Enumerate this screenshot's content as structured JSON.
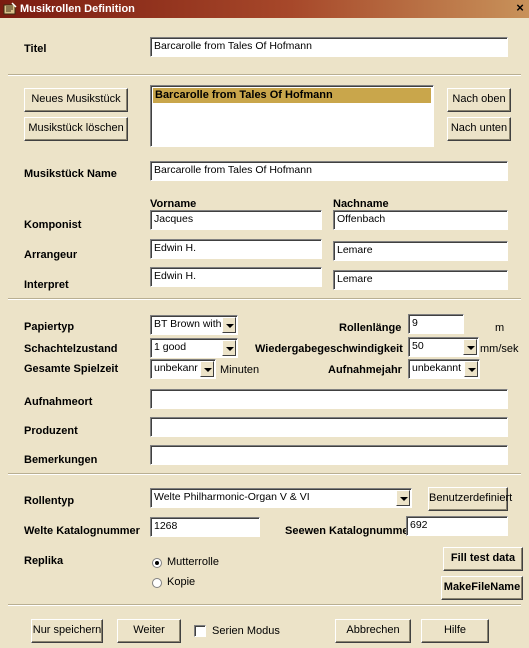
{
  "window": {
    "title": "Musikrollen Definition",
    "close_glyph": "×"
  },
  "titel": {
    "label": "Titel",
    "value": "Barcarolle from Tales Of Hofmann"
  },
  "buttons": {
    "new_piece": "Neues Musikstück",
    "delete_piece": "Musikstück löschen",
    "move_up": "Nach oben",
    "move_down": "Nach unten",
    "custom": "Benutzerdefiniert",
    "fill_test": "Fill test data",
    "make_file_name": "MakeFileName",
    "save_only": "Nur speichern",
    "next": "Weiter",
    "cancel": "Abbrechen",
    "help": "Hilfe"
  },
  "piece_list": {
    "items": [
      "Barcarolle from Tales Of Hofmann"
    ],
    "selected_index": 0
  },
  "piece_name": {
    "label": "Musikstück Name",
    "value": "Barcarolle from Tales Of Hofmann"
  },
  "people": {
    "col_first": "Vorname",
    "col_last": "Nachname",
    "rows": [
      {
        "label": "Komponist",
        "first": "Jacques",
        "last": "Offenbach"
      },
      {
        "label": "Arrangeur",
        "first": "Edwin H.",
        "last": "Lemare"
      },
      {
        "label": "Interpret",
        "first": "Edwin H.",
        "last": "Lemare"
      }
    ]
  },
  "paper_type": {
    "label": "Papiertyp",
    "value": "BT Brown with ti"
  },
  "box_state": {
    "label": "Schachtelzustand",
    "value": "1 good"
  },
  "playtime": {
    "label": "Gesamte Spielzeit",
    "value": "unbekanr",
    "unit": "Minuten"
  },
  "roll_length": {
    "label": "Rollenlänge",
    "value": "9",
    "unit": "m"
  },
  "playback_speed": {
    "label": "Wiedergabegeschwindigkeit",
    "value": "50",
    "unit": "mm/sek"
  },
  "recording_year": {
    "label": "Aufnahmejahr",
    "value": "unbekannt"
  },
  "recording_place": {
    "label": "Aufnahmeort",
    "value": ""
  },
  "producer": {
    "label": "Produzent",
    "value": ""
  },
  "remarks": {
    "label": "Bemerkungen",
    "value": ""
  },
  "roll_type": {
    "label": "Rollentyp",
    "value": "Welte Philharmonic-Organ V & VI"
  },
  "welte_catalog": {
    "label": "Welte Katalognummer",
    "value": "1268"
  },
  "seewen_catalog": {
    "label": "Seewen Katalognummer",
    "value": "692"
  },
  "replica": {
    "label": "Replika",
    "options": [
      "Mutterrolle",
      "Kopie"
    ],
    "selected": "Mutterrolle"
  },
  "series_mode": {
    "label": "Serien Modus",
    "checked": false
  }
}
